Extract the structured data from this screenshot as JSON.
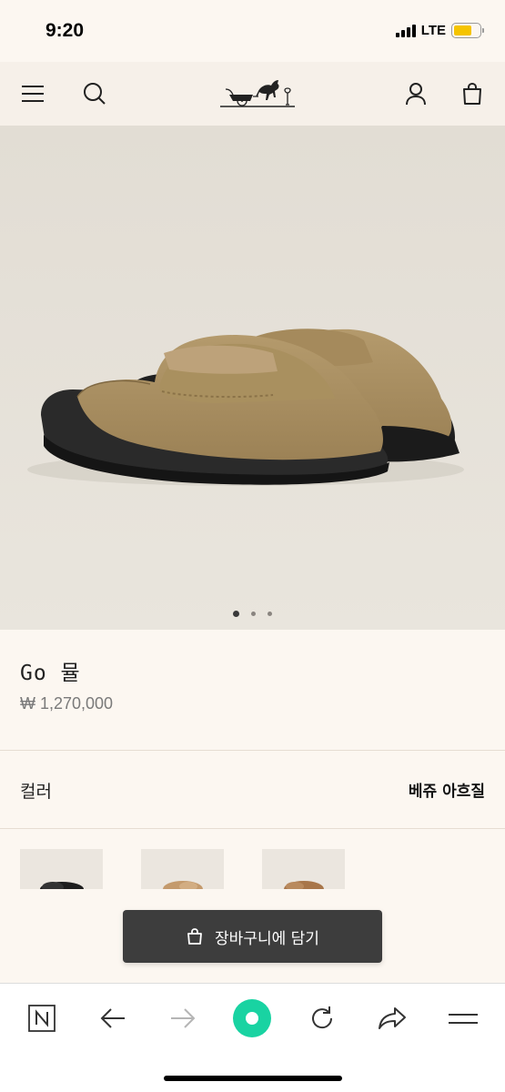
{
  "status_bar": {
    "time": "9:20",
    "network": "LTE",
    "battery_color": "#f5c400"
  },
  "header": {
    "icons": [
      "menu-icon",
      "search-icon",
      "hermes-logo",
      "account-icon",
      "shopping-bag-icon"
    ]
  },
  "hero": {
    "image": "beige suede slip-on mule with black sole",
    "slide_count": 3,
    "active_slide": 1
  },
  "product": {
    "name": "Go 뮬",
    "price": "₩ 1,270,000"
  },
  "color": {
    "label": "컬러",
    "value": "베쥬 아흐질"
  },
  "swatches": [
    {
      "name": "black",
      "color": "#1e1e1e"
    },
    {
      "name": "tan",
      "color": "#c49a6c"
    },
    {
      "name": "brown",
      "color": "#a8764a"
    }
  ],
  "cart_button": {
    "label": "장바구니에 담기"
  },
  "browser_bar": {
    "icons": [
      "naver-n-icon",
      "back-arrow-icon",
      "forward-arrow-icon",
      "green-dot-icon",
      "refresh-icon",
      "share-icon",
      "hamburger-icon"
    ],
    "accent": "#19d3a2"
  }
}
